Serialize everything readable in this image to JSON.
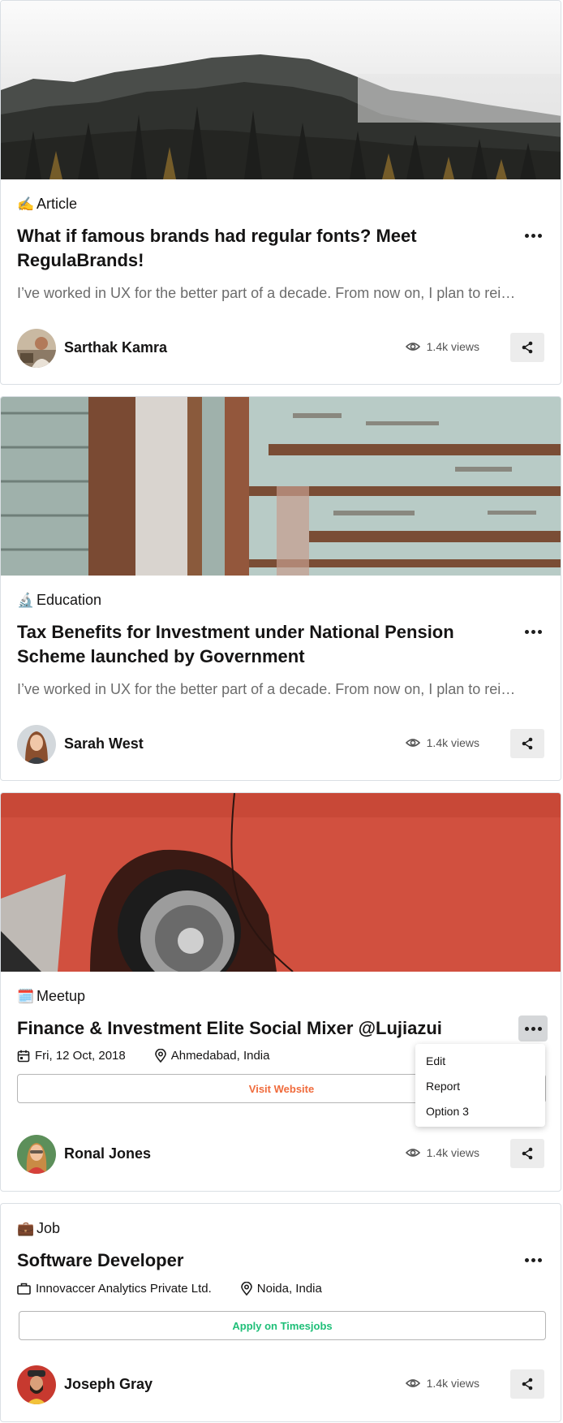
{
  "cards": [
    {
      "image_alt": "Foggy pine forest",
      "category": {
        "icon": "writing-hand-emoji",
        "emoji": "✍️",
        "label": "Article"
      },
      "title": "What if famous brands had regular fonts? Meet RegulaBrands!",
      "excerpt": "I’ve worked in UX for the better part of a decade. From now on, I plan to rei…",
      "author": "Sarthak Kamra",
      "views": "1.4k views"
    },
    {
      "image_alt": "Peeling paint on wooden wall",
      "category": {
        "icon": "microscope-emoji",
        "emoji": "🔬",
        "label": "Education"
      },
      "title": "Tax Benefits for Investment under National Pension Scheme launched by Government",
      "excerpt": "I’ve worked in UX for the better part of a decade. From now on, I plan to rei…",
      "author": "Sarah West",
      "views": "1.4k views"
    },
    {
      "image_alt": "Red car wheel",
      "category": {
        "icon": "calendar-emoji",
        "emoji": "🗓️",
        "label": "Meetup"
      },
      "title": "Finance & Investment Elite Social Mixer @Lujiazui",
      "date": "Fri, 12 Oct, 2018",
      "location": "Ahmedabad, India",
      "button": "Visit Website",
      "author": "Ronal Jones",
      "views": "1.4k views"
    },
    {
      "category": {
        "icon": "briefcase-emoji",
        "emoji": "💼",
        "label": "Job"
      },
      "title": "Software Developer",
      "company": "Innovaccer Analytics Private Ltd.",
      "location": "Noida, India",
      "button": "Apply on Timesjobs",
      "author": "Joseph Gray",
      "views": "1.4k views"
    }
  ],
  "dropdown": {
    "items": [
      "Edit",
      "Report",
      "Option 3"
    ]
  },
  "colors": {
    "visit_website": "#f06b3c",
    "apply": "#1fbf78",
    "card_border": "#dadfe4"
  }
}
